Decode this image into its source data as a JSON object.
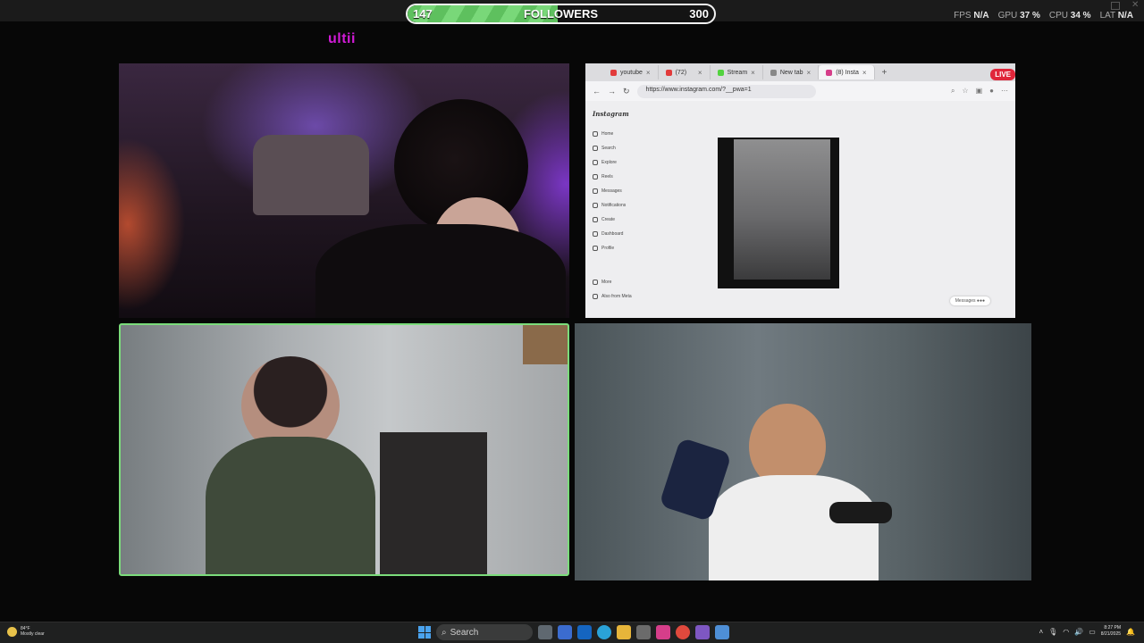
{
  "follower_goal": {
    "current": "147",
    "label": "FOLLOWERS",
    "goal": "300",
    "progress_fraction": 0.49,
    "fill_color": "#5ec05e"
  },
  "stats": [
    {
      "name": "FPS",
      "value": "N/A"
    },
    {
      "name": "GPU",
      "value": "37 %"
    },
    {
      "name": "CPU",
      "value": "34 %"
    },
    {
      "name": "LAT",
      "value": "N/A"
    }
  ],
  "brand": {
    "text": "ultii",
    "color": "#d11bd6"
  },
  "browser": {
    "tabs": [
      {
        "label": "youtube",
        "icon": "youtube-icon"
      },
      {
        "label": "(72)",
        "icon": "youtube-icon"
      },
      {
        "label": "Stream",
        "icon": "kick-icon"
      },
      {
        "label": "New tab",
        "icon": "tab-icon"
      },
      {
        "label": "(8) Insta",
        "icon": "instagram-icon",
        "active": true
      }
    ],
    "url": "https://www.instagram.com/?__pwa=1",
    "live_badge": "LIVE"
  },
  "instagram": {
    "logo": "Instagram",
    "nav": [
      "Home",
      "Search",
      "Explore",
      "Reels",
      "Messages",
      "Notifications",
      "Create",
      "Dashboard",
      "Profile"
    ],
    "bottom": [
      "More",
      "Also from Meta"
    ],
    "messages_pill": "Messages"
  },
  "taskbar": {
    "weather_temp": "84°F",
    "weather_desc": "Mostly clear",
    "search_placeholder": "Search",
    "time": "8:27 PM",
    "date": "8/21/2025"
  }
}
